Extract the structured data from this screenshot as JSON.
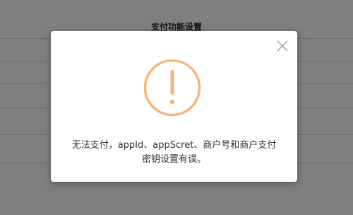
{
  "background": {
    "section_title": "支付功能设置"
  },
  "dialog": {
    "icon": "warning-exclamation-icon",
    "close_icon": "close-icon",
    "message_line1": "无法支付，appId、appScret、商户号和商户支付",
    "message_line2": "密钥设置有误。"
  },
  "colors": {
    "warning": "#f6b57c",
    "overlay": "#000000",
    "close": "#999999"
  }
}
